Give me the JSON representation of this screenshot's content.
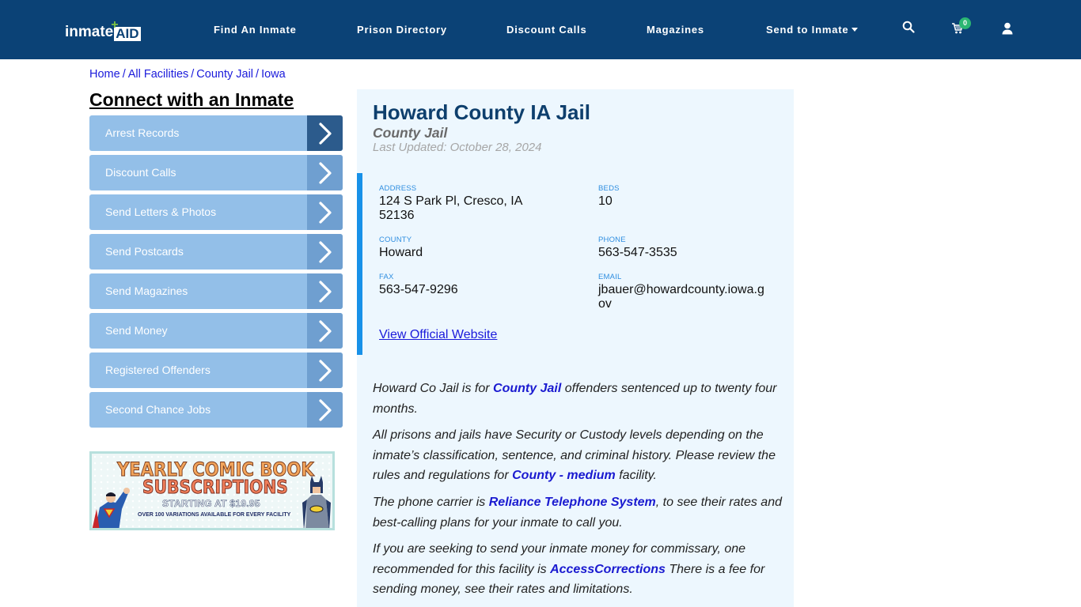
{
  "header": {
    "logo_text": "inmate",
    "logo_accent": "AID",
    "nav": [
      {
        "label": "Find An Inmate"
      },
      {
        "label": "Prison Directory"
      },
      {
        "label": "Discount Calls"
      },
      {
        "label": "Magazines"
      },
      {
        "label": "Send to Inmate",
        "has_dropdown": true
      }
    ],
    "icons": {
      "search": "search-icon",
      "cart": "cart-icon",
      "user": "user-icon"
    },
    "cart_count": "0"
  },
  "breadcrumb": [
    {
      "label": "Home"
    },
    {
      "label": "All Facilities"
    },
    {
      "label": "County Jail"
    },
    {
      "label": "Iowa"
    }
  ],
  "breadcrumb_separator": "/",
  "sidebar": {
    "title": "Connect with an Inmate",
    "items": [
      {
        "label": "Arrest Records"
      },
      {
        "label": "Discount Calls"
      },
      {
        "label": "Send Letters & Photos"
      },
      {
        "label": "Send Postcards"
      },
      {
        "label": "Send Magazines"
      },
      {
        "label": "Send Money"
      },
      {
        "label": "Registered Offenders"
      },
      {
        "label": "Second Chance Jobs"
      }
    ],
    "promo": {
      "line1": "YEARLY COMIC BOOK",
      "line2": "SUBSCRIPTIONS",
      "line3": "STARTING AT $19.95",
      "line4": "OVER 100 VARIATIONS AVAILABLE FOR EVERY FACILITY"
    }
  },
  "facility": {
    "name": "Howard County IA Jail",
    "type": "County Jail",
    "last_updated": "Last Updated: October 28, 2024",
    "fields": {
      "address": {
        "label": "ADDRESS",
        "value": "124 S Park Pl, Cresco, IA 52136"
      },
      "beds": {
        "label": "BEDS",
        "value": "10"
      },
      "county": {
        "label": "COUNTY",
        "value": "Howard"
      },
      "phone": {
        "label": "PHONE",
        "value": "563-547-3535"
      },
      "fax": {
        "label": "FAX",
        "value": "563-547-9296"
      },
      "email": {
        "label": "EMAIL",
        "value": "jbauer@howardcounty.iowa.gov"
      }
    },
    "website_link": "View Official Website"
  },
  "description": {
    "p1": {
      "before": "Howard Co Jail is for ",
      "link": "County Jail",
      "after": " offenders sentenced up to twenty four months."
    },
    "p2": {
      "before": "All prisons and jails have Security or Custody levels depending on the inmate’s classification, sentence, and criminal history. Please review the rules and regulations for ",
      "link": "County - medium",
      "after": " facility."
    },
    "p3": {
      "before": "The phone carrier is ",
      "link": "Reliance Telephone System",
      "after": ", to see their rates and best-calling plans for your inmate to call you."
    },
    "p4": {
      "before": "If you are seeking to send your inmate money for commissary, one recommended for this facility is ",
      "link": "AccessCorrections",
      "after": " There is a fee for sending money, see their rates and limitations."
    }
  },
  "colors": {
    "header_bg": "#0b4276",
    "sidebar_button": "#93bfe8",
    "sidebar_arrow_active": "#2c5b8c",
    "sidebar_arrow": "#6f9fd0",
    "panel_bg": "#edf7fe",
    "accent_bar": "#1891e8",
    "link": "#1a1adb",
    "cart_badge": "#2bb673"
  }
}
